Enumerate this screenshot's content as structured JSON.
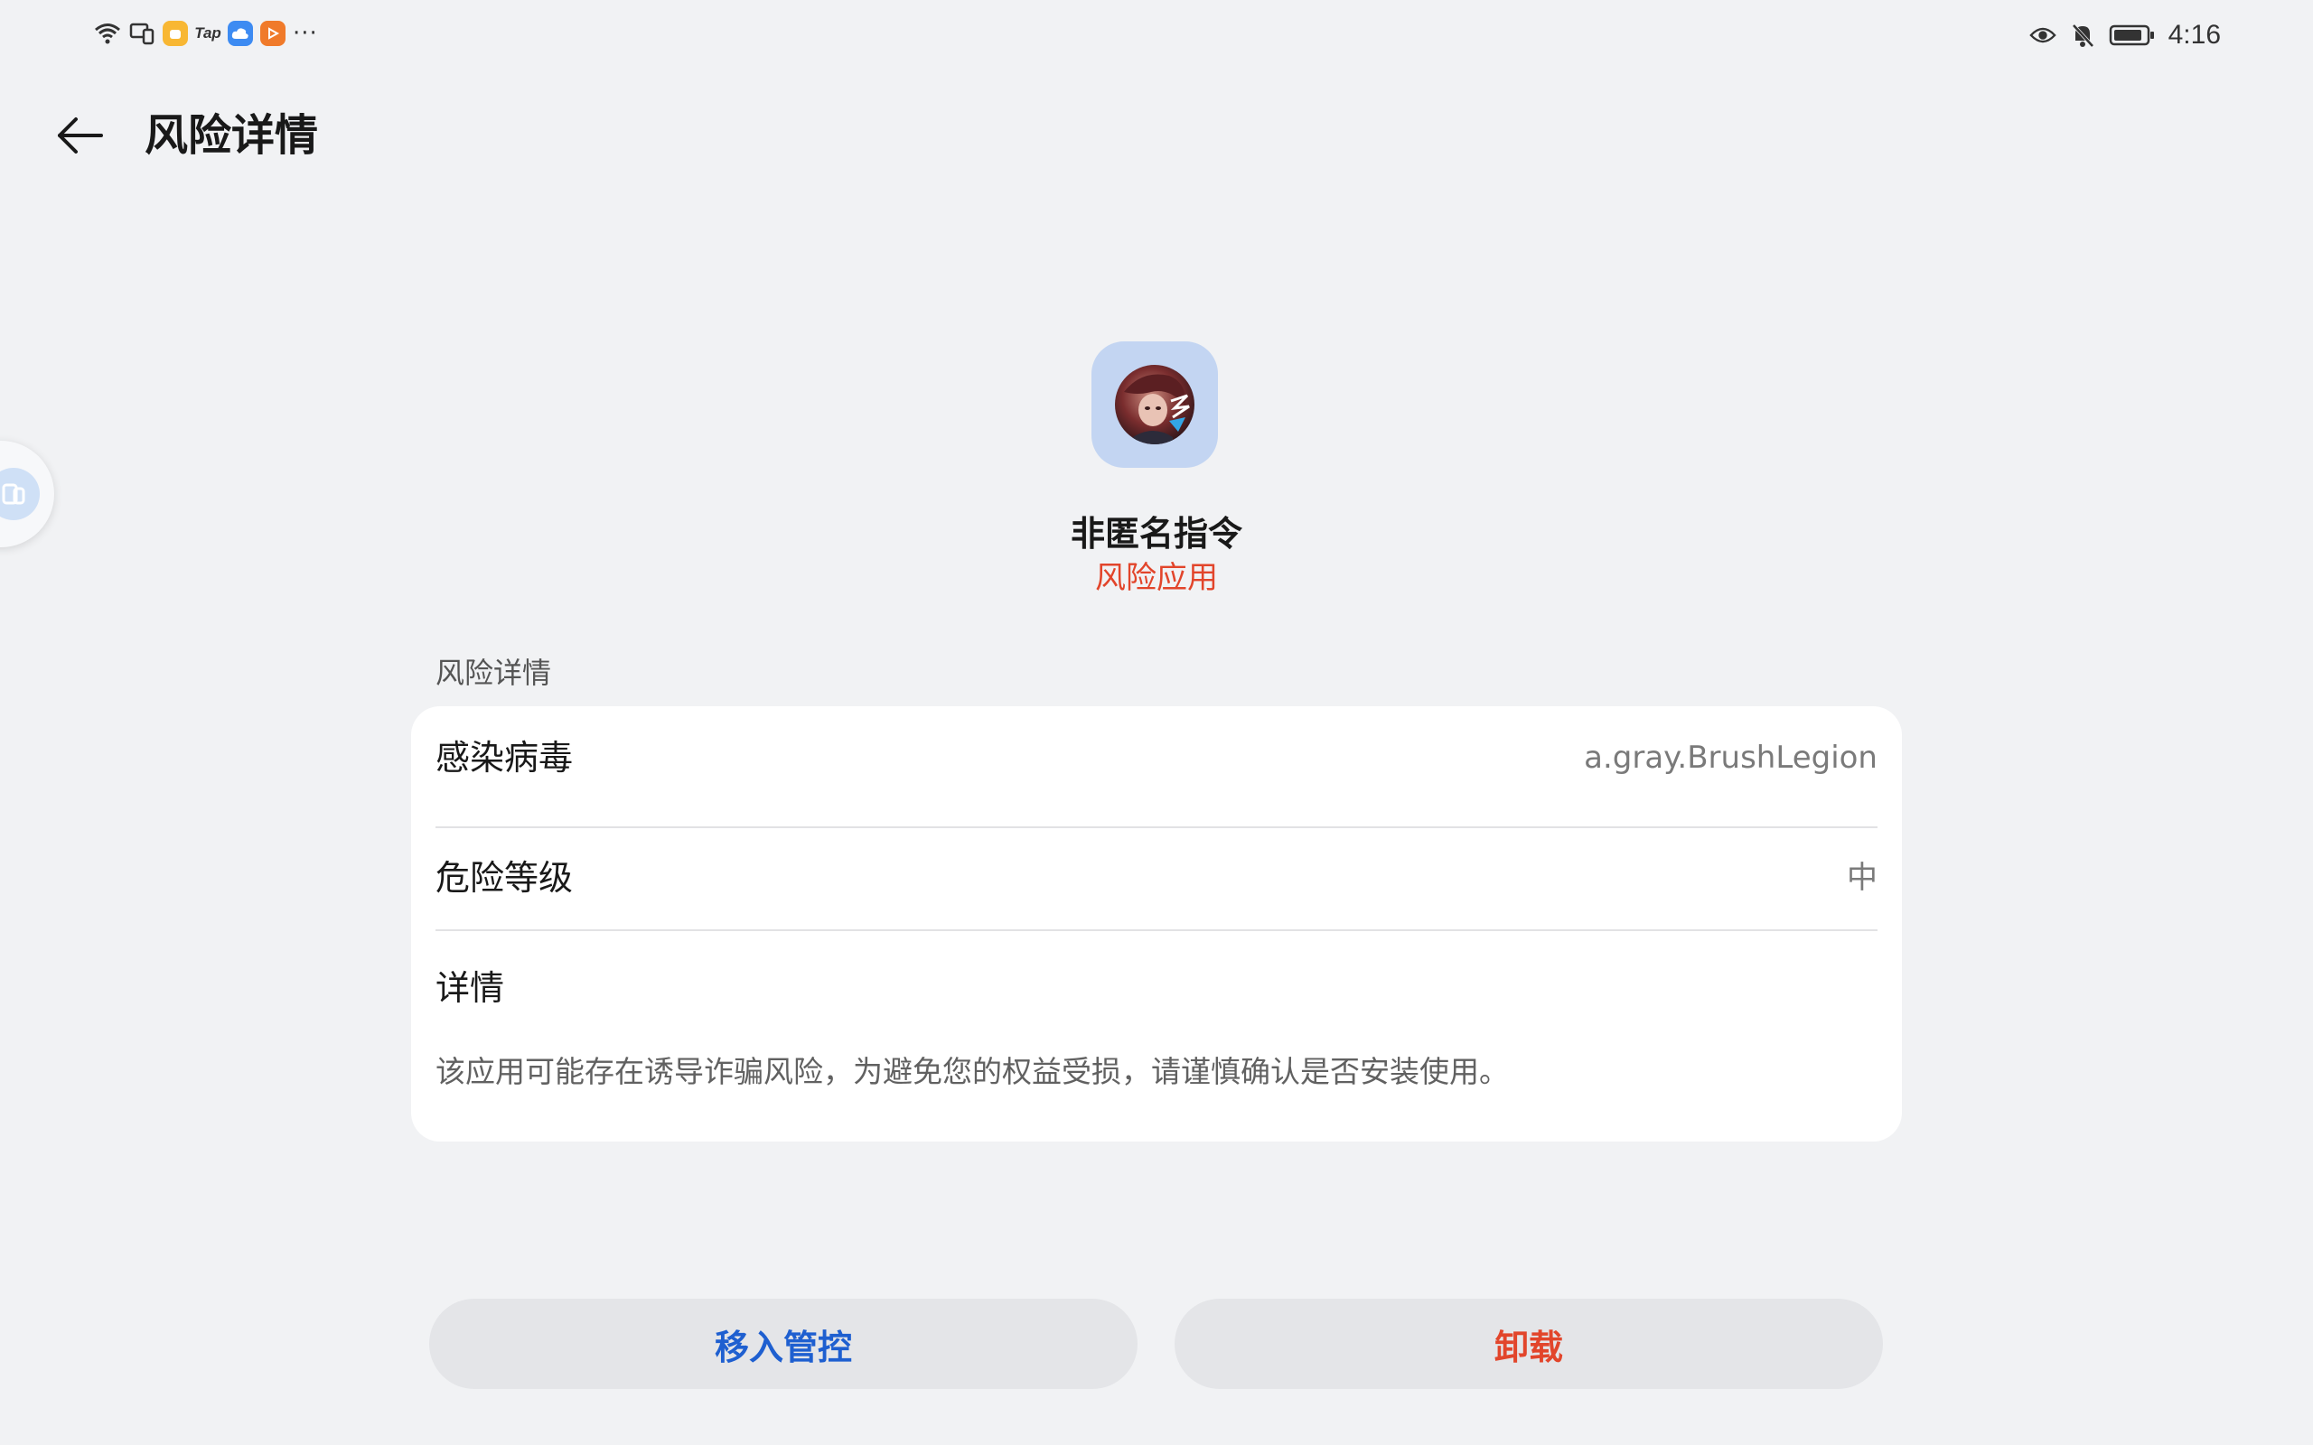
{
  "status_bar": {
    "left_icons": [
      "wifi-icon",
      "multi-device-icon",
      "yellow-app-icon",
      "tap-app-icon",
      "cloud-app-icon",
      "video-app-icon",
      "more-notifications-icon"
    ],
    "tap_label": "Tap",
    "more_label": "···",
    "right_icons": [
      "eye-comfort-icon",
      "mute-bell-icon",
      "battery-icon"
    ],
    "time": "4:16"
  },
  "header": {
    "back_icon": "back-arrow-icon",
    "title": "风险详情"
  },
  "app": {
    "name": "非匿名指令",
    "status": "风险应用",
    "status_color": "#e2452b"
  },
  "section": {
    "label": "风险详情"
  },
  "details": {
    "rows": [
      {
        "key": "感染病毒",
        "value": "a.gray.BrushLegion"
      },
      {
        "key": "危险等级",
        "value": "中"
      }
    ],
    "detail_label": "详情",
    "detail_text": "该应用可能存在诱导诈骗风险，为避免您的权益受损，请谨慎确认是否安装使用。"
  },
  "actions": {
    "control_label": "移入管控",
    "control_color": "#1e5fd0",
    "uninstall_label": "卸载",
    "uninstall_color": "#e2452b"
  }
}
